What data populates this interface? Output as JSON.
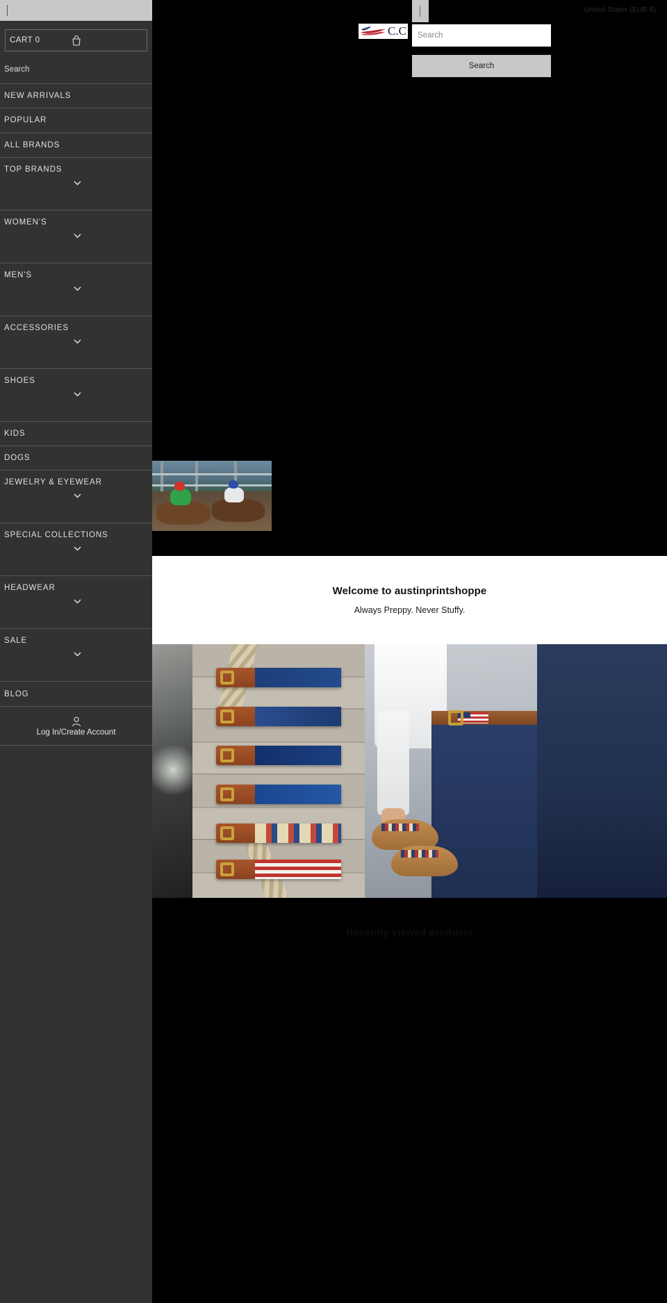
{
  "sidebar": {
    "search_box": {
      "value": "",
      "placeholder": ""
    },
    "cart": {
      "label": "CART 0",
      "icon": "shopping-bag-icon"
    },
    "search_link": "Search",
    "nav_items": [
      {
        "label": "NEW ARRIVALS",
        "expandable": false
      },
      {
        "label": "POPULAR",
        "expandable": false
      },
      {
        "label": "ALL BRANDS",
        "expandable": false
      },
      {
        "label": "TOP BRANDS",
        "expandable": true
      },
      {
        "label": "WOMEN'S",
        "expandable": true
      },
      {
        "label": "MEN'S",
        "expandable": true
      },
      {
        "label": "ACCESSORIES",
        "expandable": true
      },
      {
        "label": "SHOES",
        "expandable": true
      },
      {
        "label": "KIDS",
        "expandable": false
      },
      {
        "label": "DOGS",
        "expandable": false
      },
      {
        "label": "JEWELRY & EYEWEAR",
        "expandable": true
      },
      {
        "label": "SPECIAL COLLECTIONS",
        "expandable": true
      },
      {
        "label": "HEADWEAR",
        "expandable": true
      },
      {
        "label": "SALE",
        "expandable": true
      },
      {
        "label": "BLOG",
        "expandable": false
      }
    ],
    "account": {
      "label": "Log In/Create Account",
      "icon": "user-icon"
    }
  },
  "header": {
    "locale": "United States (EUR €)",
    "logo_text": "C.C",
    "logo_icon": "usa-flag-logo-icon"
  },
  "search_panel": {
    "input_value": "",
    "input_placeholder": "Search",
    "submit_label": "Search"
  },
  "main": {
    "welcome_title": "Welcome to austinprintshoppe",
    "welcome_subtitle": "Always Preppy. Never Stuffy.",
    "section_heading": "Recently viewed products"
  },
  "colors": {
    "sidebar_bg": "#323232",
    "sidebar_divider": "#555555",
    "page_bg": "#000000",
    "panel_gray": "#c8c8c8",
    "text_light": "#e0e0e0"
  }
}
